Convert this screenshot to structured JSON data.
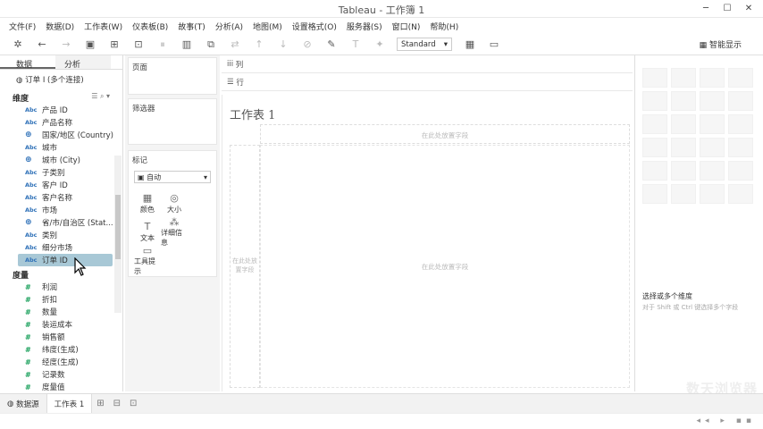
{
  "window": {
    "title": "Tableau - 工作簿 1",
    "controls": [
      "─",
      "☐",
      "✕"
    ]
  },
  "menu": [
    "文件(F)",
    "数据(D)",
    "工作表(W)",
    "仪表板(B)",
    "故事(T)",
    "分析(A)",
    "地图(M)",
    "设置格式(O)",
    "服务器(S)",
    "窗口(N)",
    "帮助(H)"
  ],
  "toolbar": {
    "fit_select": "Standard",
    "smart_show": "智能显示"
  },
  "left": {
    "tabs": [
      "数据",
      "分析"
    ],
    "source": "订单 I (多个连接)",
    "dimensions_header": "维度",
    "dimensions": [
      {
        "type": "Abc",
        "name": "产品 ID"
      },
      {
        "type": "Abc",
        "name": "产品名称"
      },
      {
        "type": "geo",
        "name": "国家/地区 (Country)"
      },
      {
        "type": "Abc",
        "name": "城市"
      },
      {
        "type": "geo",
        "name": "城市 (City)"
      },
      {
        "type": "Abc",
        "name": "子类别"
      },
      {
        "type": "Abc",
        "name": "客户 ID"
      },
      {
        "type": "Abc",
        "name": "客户名称"
      },
      {
        "type": "Abc",
        "name": "市场"
      },
      {
        "type": "geo",
        "name": "省/市/自治区 (Stat..."
      },
      {
        "type": "Abc",
        "name": "类别"
      },
      {
        "type": "Abc",
        "name": "细分市场"
      }
    ],
    "selected_field": {
      "type": "Abc",
      "name": "订单 ID"
    },
    "measures_header": "度量",
    "measures": [
      "利润",
      "折扣",
      "数量",
      "装运成本",
      "销售额",
      "纬度(生成)",
      "经度(生成)",
      "记录数",
      "度量值"
    ]
  },
  "cards": {
    "pages": "页面",
    "filters": "筛选器",
    "marks": "标记",
    "marks_type": "自动",
    "mark_buttons": [
      {
        "icon": "▦",
        "label": "颜色"
      },
      {
        "icon": "◎",
        "label": "大小"
      },
      {
        "icon": "T",
        "label": "文本"
      },
      {
        "icon": "⁂",
        "label": "详细信息"
      },
      {
        "icon": "▭",
        "label": "工具提示"
      }
    ]
  },
  "shelves": {
    "columns": "列",
    "rows": "行"
  },
  "view": {
    "title": "工作表 1",
    "drop_column": "在此处放置字段",
    "drop_row": "在此处放置字段",
    "drop_field": "在此处放置字段"
  },
  "showme": {
    "hint": "选择或多个维度",
    "hint_detail": "对于 Shift 或 Ctrl 键选择多个字段"
  },
  "watermark": "数天浏览器",
  "bottom": {
    "data_source": "数据源",
    "sheet": "工作表 1"
  }
}
